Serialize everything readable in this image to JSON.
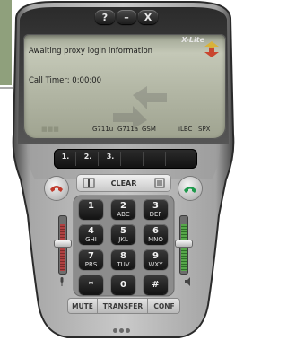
{
  "window": {
    "help_label": "?",
    "minimize_label": "–",
    "close_label": "X"
  },
  "lcd": {
    "brand": "X-Lite",
    "status": "Awaiting proxy login information",
    "timer": "Call Timer: 0:00:00",
    "codecs": [
      "G711u",
      "G711a",
      "GSM",
      "iLBC",
      "SPX"
    ]
  },
  "lines": [
    {
      "label": "1."
    },
    {
      "label": "2."
    },
    {
      "label": "3."
    }
  ],
  "controls": {
    "clear_label": "CLEAR"
  },
  "keypad": [
    {
      "digit": "1",
      "letters": ""
    },
    {
      "digit": "2",
      "letters": "ABC"
    },
    {
      "digit": "3",
      "letters": "DEF"
    },
    {
      "digit": "4",
      "letters": "GHI"
    },
    {
      "digit": "5",
      "letters": "JKL"
    },
    {
      "digit": "6",
      "letters": "MNO"
    },
    {
      "digit": "7",
      "letters": "PRS"
    },
    {
      "digit": "8",
      "letters": "TUV"
    },
    {
      "digit": "9",
      "letters": "WXY"
    },
    {
      "digit": "*",
      "letters": ""
    },
    {
      "digit": "0",
      "letters": ""
    },
    {
      "digit": "#",
      "letters": ""
    }
  ],
  "bottom": {
    "mute_label": "MUTE",
    "transfer_label": "TRANSFER",
    "conf_label": "CONF"
  },
  "colors": {
    "hangup": "#c0392b",
    "call": "#1f9a4c",
    "mic_level": "#b04040",
    "speaker_level": "#57a74a"
  }
}
